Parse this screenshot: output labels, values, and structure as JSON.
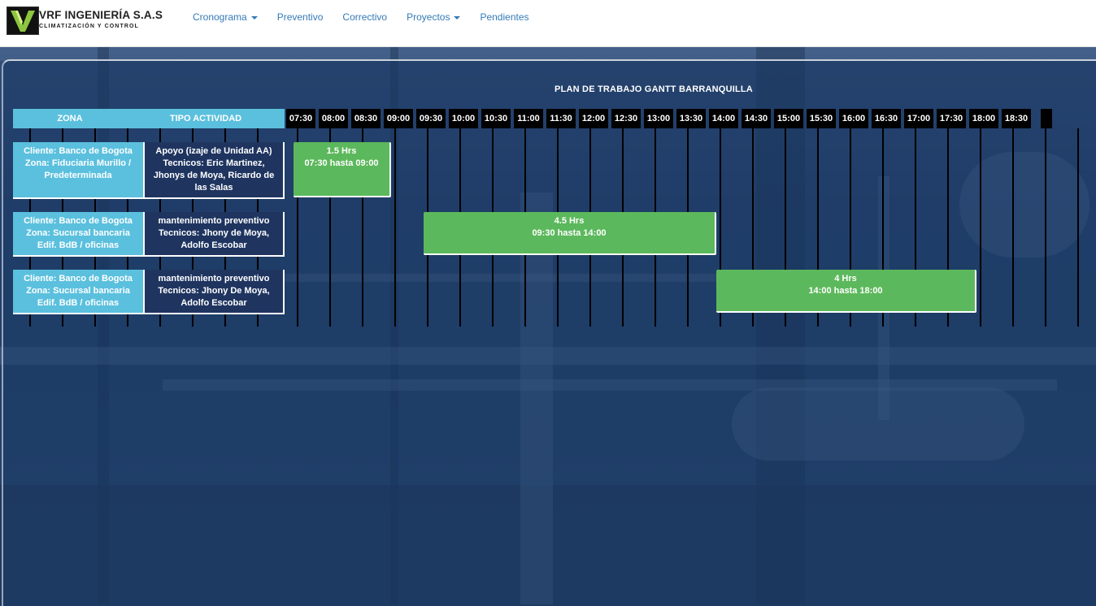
{
  "brand": {
    "title": "VRF INGENIERÍA S.A.S",
    "subtitle": "CLIMATIZACIÓN Y CONTROL"
  },
  "nav": [
    {
      "label": "Cronograma",
      "dropdown": true
    },
    {
      "label": "Preventivo",
      "dropdown": false
    },
    {
      "label": "Correctivo",
      "dropdown": false
    },
    {
      "label": "Proyectos",
      "dropdown": true
    },
    {
      "label": "Pendientes",
      "dropdown": false
    }
  ],
  "gantt": {
    "title": "PLAN DE TRABAJO GANTT BARRANQUILLA",
    "headers": {
      "zona": "ZONA",
      "tipo": "TIPO ACTIVIDAD"
    },
    "times": [
      "07:30",
      "08:00",
      "08:30",
      "09:00",
      "09:30",
      "10:00",
      "10:30",
      "11:00",
      "11:30",
      "12:00",
      "12:30",
      "13:00",
      "13:30",
      "14:00",
      "14:30",
      "15:00",
      "15:30",
      "16:00",
      "16:30",
      "17:00",
      "17:30",
      "18:00",
      "18:30"
    ],
    "rows": [
      {
        "zona": [
          "Cliente: Banco de Bogota",
          "Zona: Fiduciaria Murillo /",
          "Predeterminada"
        ],
        "tipo": [
          "Apoyo (izaje de Unidad AA)",
          "Tecnicos: Eric Martinez,",
          "Jhonys de Moya, Ricardo de",
          "las Salas"
        ],
        "bar": {
          "duration": "1.5 Hrs",
          "range": "07:30 hasta 09:00",
          "start": "07:30",
          "end": "09:00"
        }
      },
      {
        "zona": [
          "Cliente: Banco de Bogota",
          "Zona: Sucursal bancaria",
          "Edif. BdB / oficinas"
        ],
        "tipo": [
          "mantenimiento preventivo",
          "Tecnicos: Jhony de Moya,",
          "Adolfo Escobar"
        ],
        "bar": {
          "duration": "4.5 Hrs",
          "range": "09:30 hasta 14:00",
          "start": "09:30",
          "end": "14:00"
        }
      },
      {
        "zona": [
          "Cliente: Banco de Bogota",
          "Zona: Sucursal bancaria",
          "Edif. BdB / oficinas"
        ],
        "tipo": [
          "mantenimiento preventivo",
          "Tecnicos: Jhony De Moya,",
          "Adolfo Escobar"
        ],
        "bar": {
          "duration": "4 Hrs",
          "range": "14:00 hasta 18:00",
          "start": "14:00",
          "end": "18:00"
        }
      }
    ]
  },
  "colors": {
    "zona": "#5bc0de",
    "bar": "#5cb85c",
    "link": "#337ab7",
    "timeHeader": "#000000"
  }
}
